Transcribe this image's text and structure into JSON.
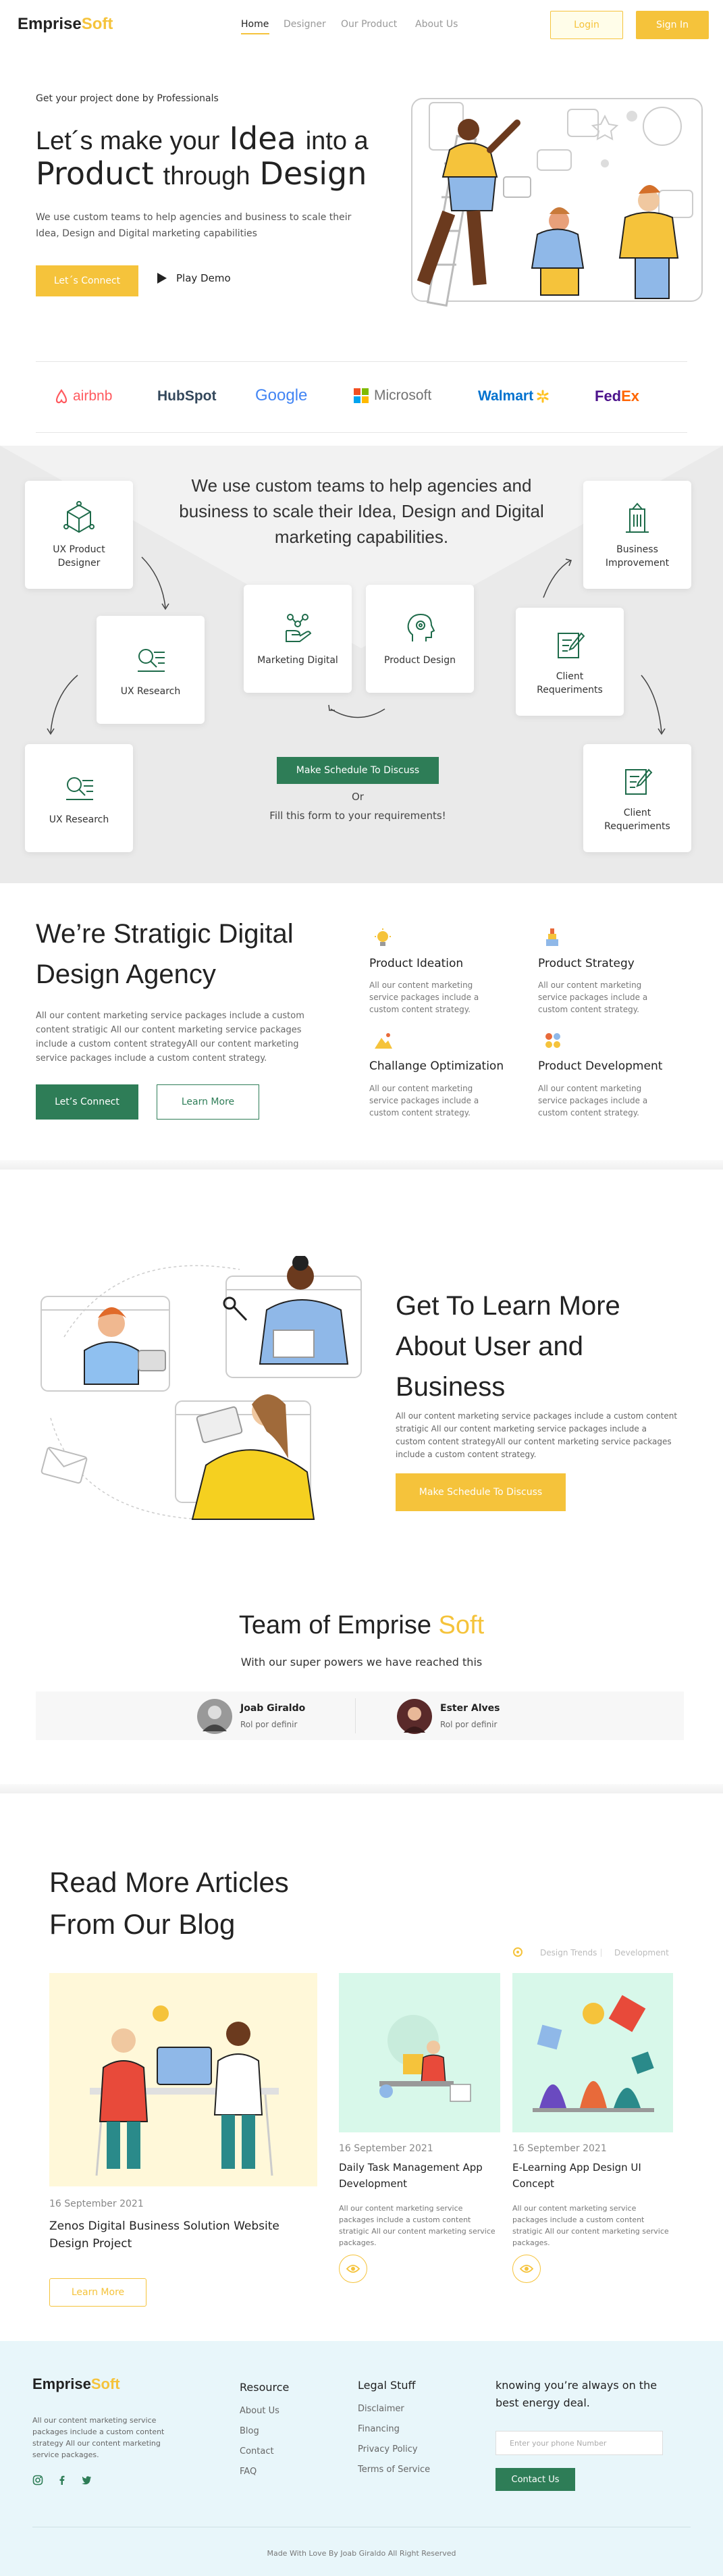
{
  "nav": {
    "logo_main": "Emprise",
    "logo_accent": "Soft",
    "links": [
      "Home",
      "Designer",
      "Our Product",
      "About Us"
    ],
    "login": "Login",
    "signin": "Sign In"
  },
  "hero": {
    "kicker": "Get your project done by Professionals",
    "l1a": "Let´s make your",
    "l1b": "Idea",
    "l1c": "into a",
    "l2a": "Product",
    "l2b": "through",
    "l2c": "Design",
    "desc": "We use custom teams to help agencies and business to scale their Idea, Design and Digital marketing capabilities",
    "cta": "Let´s Connect",
    "play": "Play Demo"
  },
  "brands": [
    "airbnb",
    "HubSpot",
    "Google",
    "Microsoft",
    "Walmart",
    "FedEx"
  ],
  "services": {
    "title": "We use custom teams to help agencies and business to scale their Idea, Design and Digital marketing capabilities.",
    "cards": [
      {
        "label": "UX Product Designer",
        "icon": "cube-icon"
      },
      {
        "label": "Business Improvement",
        "icon": "building-icon"
      },
      {
        "label": "UX Research",
        "icon": "search-list-icon"
      },
      {
        "label": "Marketing Digital",
        "icon": "hand-network-icon"
      },
      {
        "label": "Product Design",
        "icon": "head-gear-icon"
      },
      {
        "label": "Client Requeriments",
        "icon": "document-pen-icon"
      },
      {
        "label": "UX Research",
        "icon": "search-list-icon"
      },
      {
        "label": "Client Requeriments",
        "icon": "document-pen-icon"
      }
    ],
    "cta": "Make Schedule To Discuss",
    "or": "Or",
    "fill": "Fill this form to your requirements!"
  },
  "agency": {
    "title_1": "We’re Stratigic Digital",
    "title_2": "Design Agency",
    "desc": "All our content marketing service packages  include a custom content stratigic All our content marketing service packages include a custom content strategyAll our content marketing service packages include a custom content strategy.",
    "cta": "Let’s Connect",
    "learn": "Learn More",
    "features": [
      {
        "title": "Product Ideation",
        "text": "All our content marketing service packages  include a custom content strategy."
      },
      {
        "title": "Product Strategy",
        "text": "All our content marketing service packages  include a custom content strategy."
      },
      {
        "title": "Challange Optimization",
        "text": "All our content marketing service packages  include a custom content strategy."
      },
      {
        "title": "Product Development",
        "text": "All our content marketing service packages  include a custom content strategy."
      }
    ]
  },
  "learn": {
    "t1": "Get To Learn More",
    "t2": "About User and",
    "t3": "Business",
    "desc": "All our content marketing service packages include a custom content stratigic All our content marketing service packages include a custom content strategyAll our content marketing service packages include a custom content strategy.",
    "cta": "Make Schedule To Discuss"
  },
  "team": {
    "title_a": "Team of",
    "title_b": "Emprise",
    "title_c": "Soft",
    "sub": "With our super powers we have reached this",
    "members": [
      {
        "name": "Joab Giraldo",
        "role": "Rol por definir"
      },
      {
        "name": "Ester Alves",
        "role": "Rol por definir"
      }
    ]
  },
  "blog": {
    "title_1": "Read More Articles",
    "title_2": "From Our Blog",
    "filters": [
      "Design Trends",
      "Development"
    ],
    "posts": [
      {
        "date": "16 September 2021",
        "title": "Zenos Digital Business Solution Website Design Project",
        "button": "Learn More"
      },
      {
        "date": "16 September 2021",
        "title": "Daily Task Management App Development",
        "text": "All our content marketing service packages include a custom content stratigic All our content marketing service packages."
      },
      {
        "date": "16 September 2021",
        "title": "E-Learning App Design UI Concept",
        "text": "All our content marketing service packages include a custom content stratigic All our content marketing service packages."
      }
    ]
  },
  "footer": {
    "logo_main": "Emprise",
    "logo_accent": "Soft",
    "desc": "All our content marketing service packages include a custom content strategy All our content marketing service packages.",
    "resource_head": "Resource",
    "resource": [
      "About Us",
      "Blog",
      "Contact",
      "FAQ"
    ],
    "legal_head": "Legal Stuff",
    "legal": [
      "Disclaimer",
      "Financing",
      "Privacy Policy",
      "Terms of Service"
    ],
    "newsletter": "knowing you’re always on the best energy deal.",
    "phone_placeholder": "Enter your phone Number",
    "contact_btn": "Contact Us",
    "copyright": "Made With Love By Joab Giraldo All Right Reserved"
  },
  "colors": {
    "accent": "#f5c33b",
    "green": "#2e7d57"
  }
}
